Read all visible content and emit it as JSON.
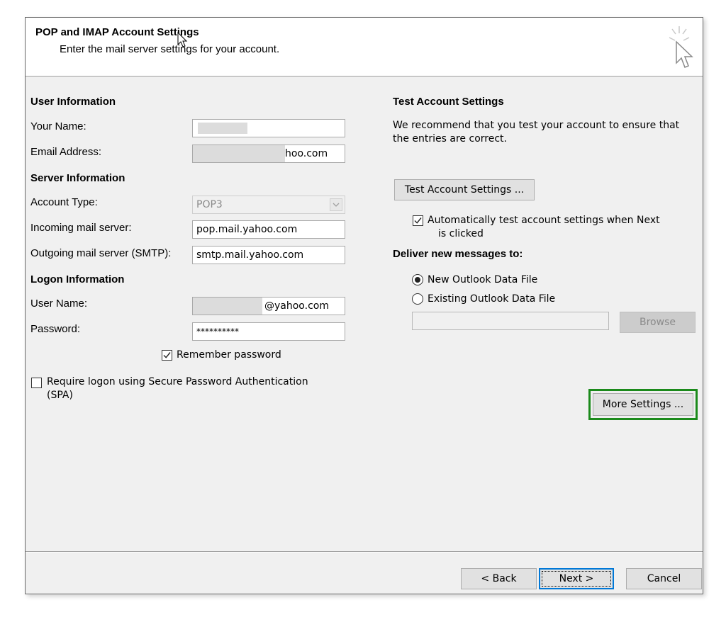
{
  "header": {
    "title": "POP and IMAP Account Settings",
    "subtitle": "Enter the mail server settings for your account."
  },
  "user_info": {
    "heading": "User Information",
    "name_label": "Your Name:",
    "name_value": "",
    "email_label": "Email Address:",
    "email_value": "hoo.com"
  },
  "server_info": {
    "heading": "Server Information",
    "account_type_label": "Account Type:",
    "account_type_value": "POP3",
    "incoming_label": "Incoming mail server:",
    "incoming_value": "pop.mail.yahoo.com",
    "outgoing_label": "Outgoing mail server (SMTP):",
    "outgoing_value": "smtp.mail.yahoo.com"
  },
  "logon_info": {
    "heading": "Logon Information",
    "user_label": "User Name:",
    "user_value": "@yahoo.com",
    "password_label": "Password:",
    "password_value": "**********",
    "remember_label": "Remember password",
    "remember_checked": true,
    "spa_label_1": "Require logon using Secure Password Authentication",
    "spa_label_2": "(SPA)",
    "spa_checked": false
  },
  "test": {
    "heading": "Test Account Settings",
    "desc_1": "We recommend that you test your account to ensure that",
    "desc_2": "the entries are correct.",
    "button": "Test Account Settings ...",
    "auto_label_1": "Automatically test account settings when Next",
    "auto_label_2": "is clicked",
    "auto_checked": true
  },
  "deliver": {
    "heading": "Deliver new messages to:",
    "option_new": "New Outlook Data File",
    "option_existing": "Existing Outlook Data File",
    "selected": "new",
    "path_value": "",
    "browse": "Browse"
  },
  "more_settings": "More Settings ...",
  "footer": {
    "back": "< Back",
    "next": "Next >",
    "cancel": "Cancel"
  },
  "colors": {
    "highlight": "#1b8a1b",
    "default_button_border": "#0078d7"
  },
  "icons": [
    "wizard-cursor-icon",
    "check-icon",
    "chevron-down-icon"
  ]
}
